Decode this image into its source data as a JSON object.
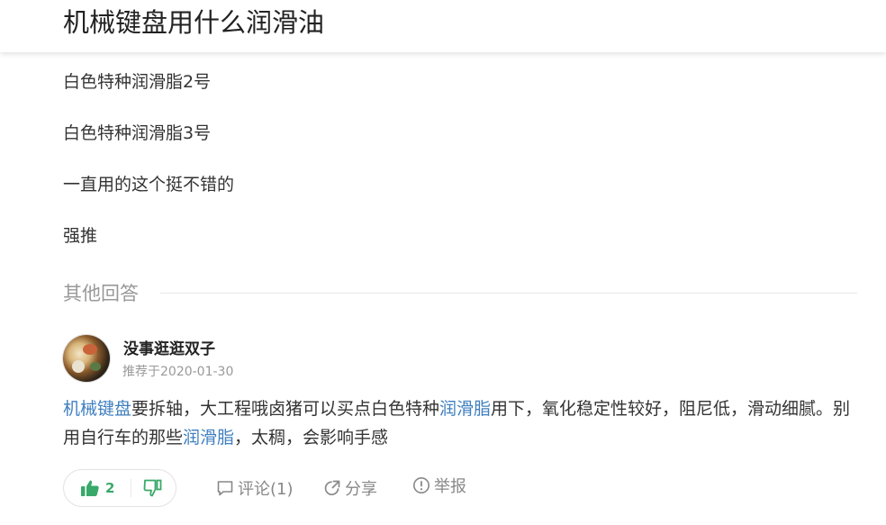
{
  "header": {
    "title": "机械键盘用什么润滑油"
  },
  "answer": {
    "lines": [
      "白色特种润滑脂2号",
      "白色特种润滑脂3号",
      "一直用的这个挺不错的",
      "强推"
    ]
  },
  "other_answers": {
    "heading": "其他回答"
  },
  "reply": {
    "author": "没事逛逛双子",
    "date": "推荐于2020-01-30",
    "segments": [
      {
        "text": "机械键盘",
        "link": true
      },
      {
        "text": "要拆轴，大工程哦卤猪可以买点白色特种",
        "link": false
      },
      {
        "text": "润滑脂",
        "link": true
      },
      {
        "text": "用下，氧化稳定性较好，阻尼低，滑动细腻。别用自行车的那些",
        "link": false
      },
      {
        "text": "润滑脂",
        "link": true
      },
      {
        "text": "，太稠，会影响手感",
        "link": false
      }
    ],
    "upvotes": "2",
    "comment_label": "评论(1)",
    "share_label": "分享",
    "report_label": "举报"
  },
  "colors": {
    "link": "#3f7fbf",
    "upvote_green": "#39a96b",
    "muted": "#999999"
  },
  "icons": {
    "upvote": "thumbs-up-icon",
    "downvote": "thumbs-down-icon",
    "comment": "comment-icon",
    "share": "share-icon",
    "report": "report-icon"
  }
}
